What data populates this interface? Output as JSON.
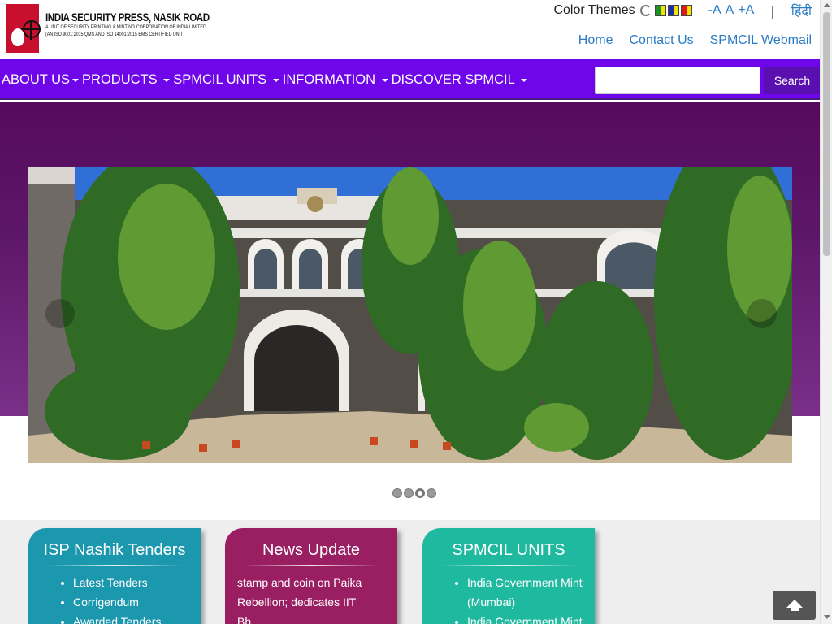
{
  "header": {
    "logo_title": "INDIA SECURITY PRESS, NASIK ROAD",
    "logo_sub1": "A UNIT OF SECURITY PRINTING & MINTING CORPORATION OF INDIA LIMITED",
    "logo_sub2": "(AN ISO 9001:2015 QMS AND ISO 14001:2015 EMS CERTIFIED UNIT)",
    "color_themes_label": "Color Themes",
    "font_decrease": "-A",
    "font_normal": "A",
    "font_increase": "+A",
    "separator": "|",
    "hindi_link": "हिंदी",
    "links": [
      "Home",
      "Contact Us",
      "SPMCIL Webmail"
    ]
  },
  "nav": {
    "items": [
      "ABOUT US",
      "PRODUCTS",
      "SPMCIL UNITS",
      "INFORMATION",
      "DISCOVER SPMCIL"
    ],
    "search_placeholder": "",
    "search_button": "Search"
  },
  "carousel": {
    "slide_count": 4,
    "active_index": 2
  },
  "cards": {
    "tenders": {
      "title": "ISP Nashik Tenders",
      "items": [
        "Latest Tenders",
        "Corrigendum",
        "Awarded Tenders"
      ]
    },
    "news": {
      "title": "News Update",
      "text": "stamp and coin on Paika Rebellion; dedicates IIT Bh......"
    },
    "units": {
      "title": "SPMCIL UNITS",
      "items": [
        "India Government Mint (Mumbai)",
        "India Government Mint"
      ]
    }
  },
  "colors": {
    "navbar": "#6f05e9",
    "hero": "#560a5e",
    "card_tenders": "#1b97ae",
    "card_news": "#9a1f62",
    "card_units": "#1fb9a0",
    "link": "#2a7cc7"
  }
}
